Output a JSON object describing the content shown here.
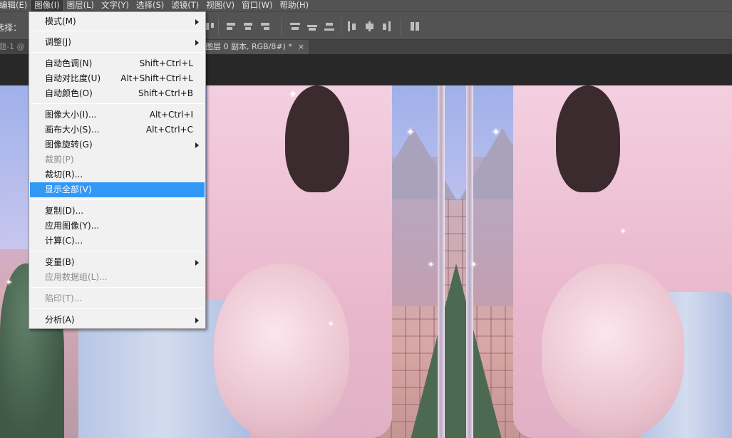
{
  "menubar": {
    "items": [
      {
        "label": "编辑(E)"
      },
      {
        "label": "图像(I)"
      },
      {
        "label": "图层(L)"
      },
      {
        "label": "文字(Y)"
      },
      {
        "label": "选择(S)"
      },
      {
        "label": "滤镜(T)"
      },
      {
        "label": "视图(V)"
      },
      {
        "label": "窗口(W)"
      },
      {
        "label": "帮助(H)"
      }
    ]
  },
  "optionsbar": {
    "label": "选择：",
    "icons": [
      "align-top-edges-icon",
      "align-vertical-centers-icon",
      "align-bottom-edges-icon",
      "distribute-top-icon",
      "distribute-vcenter-icon",
      "distribute-bottom-icon",
      "distribute-left-icon",
      "distribute-hcenter-icon",
      "distribute-right-icon",
      "auto-align-icon"
    ]
  },
  "tabs": {
    "left": "题-1 @",
    "active": "图层 0 副本, RGB/8#) *",
    "close": "×"
  },
  "image_menu": {
    "items": [
      {
        "label": "模式(M)",
        "shortcut": "",
        "submenu": true,
        "disabled": false
      },
      {
        "label": "调整(J)",
        "shortcut": "",
        "submenu": true,
        "disabled": false
      },
      {
        "label": "自动色调(N)",
        "shortcut": "Shift+Ctrl+L",
        "submenu": false,
        "disabled": false
      },
      {
        "label": "自动对比度(U)",
        "shortcut": "Alt+Shift+Ctrl+L",
        "submenu": false,
        "disabled": false
      },
      {
        "label": "自动颜色(O)",
        "shortcut": "Shift+Ctrl+B",
        "submenu": false,
        "disabled": false
      },
      {
        "label": "图像大小(I)...",
        "shortcut": "Alt+Ctrl+I",
        "submenu": false,
        "disabled": false
      },
      {
        "label": "画布大小(S)...",
        "shortcut": "Alt+Ctrl+C",
        "submenu": false,
        "disabled": false
      },
      {
        "label": "图像旋转(G)",
        "shortcut": "",
        "submenu": true,
        "disabled": false
      },
      {
        "label": "裁剪(P)",
        "shortcut": "",
        "submenu": false,
        "disabled": true
      },
      {
        "label": "裁切(R)...",
        "shortcut": "",
        "submenu": false,
        "disabled": false
      },
      {
        "label": "显示全部(V)",
        "shortcut": "",
        "submenu": false,
        "disabled": false,
        "highlighted": true
      },
      {
        "label": "复制(D)...",
        "shortcut": "",
        "submenu": false,
        "disabled": false
      },
      {
        "label": "应用图像(Y)...",
        "shortcut": "",
        "submenu": false,
        "disabled": false
      },
      {
        "label": "计算(C)...",
        "shortcut": "",
        "submenu": false,
        "disabled": false
      },
      {
        "label": "变量(B)",
        "shortcut": "",
        "submenu": true,
        "disabled": false
      },
      {
        "label": "应用数据组(L)...",
        "shortcut": "",
        "submenu": false,
        "disabled": true
      },
      {
        "label": "陷印(T)...",
        "shortcut": "",
        "submenu": false,
        "disabled": true
      },
      {
        "label": "分析(A)",
        "shortcut": "",
        "submenu": true,
        "disabled": false
      }
    ]
  },
  "colors": {
    "chrome": "#535353",
    "menu_bg": "#f1f1f1",
    "highlight": "#3298f5"
  }
}
